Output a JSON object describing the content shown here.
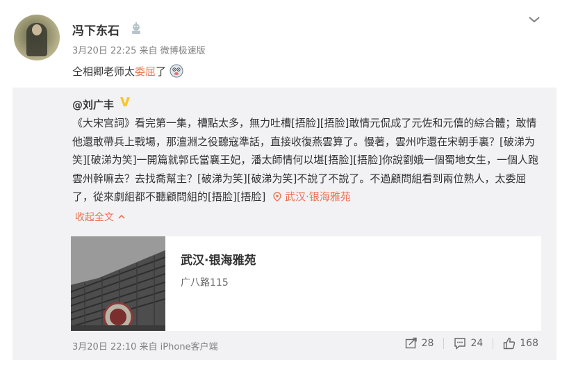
{
  "post": {
    "username": "冯下东石",
    "meta": "3月20日 22:25 来自 微博极速版",
    "text_before": "仝相卿老师太",
    "text_highlight": "委屈",
    "text_after": "了"
  },
  "quoted": {
    "author": "@刘广丰",
    "body": "《大宋宫詞》看完第一集，槽點太多，無力吐槽[捂脸][捂脸]敢情元侃成了元佐和元僖的綜合體；敢情他還敢帶兵上戰場，那澶淵之役聽寇準話，直接收復燕雲算了。慢著，雲州咋還在宋朝手裏？[破涕为笑][破涕为笑]一開篇就郭氏當襄王妃，潘太師情何以堪[捂脸][捂脸]你說劉娥一個蜀地女生，一個人跑雲州幹嘛去？去找喬幫主？[破涕为笑][破涕为笑]不說了不說了。不過顧問組看到兩位熟人，太委屈了，從來劇組都不聽顧問組的[捂脸][捂脸]",
    "location": "武汉·银海雅苑",
    "collapse_label": "收起全文",
    "card": {
      "title": "武汉·银海雅苑",
      "subtitle": "广八路115"
    },
    "footer_meta": "3月20日 22:10 来自 iPhone客户端",
    "reposts": "28",
    "comments": "24",
    "likes": "168"
  },
  "colors": {
    "accent": "#eb7350",
    "quote_bg": "#f2f2f5",
    "vbadge": "#f7c52d"
  },
  "icons": [
    "chevron-down-icon",
    "user-badge-icon",
    "emoji-icon",
    "vip-badge-icon",
    "location-pin-icon",
    "chevron-up-icon",
    "repost-icon",
    "comment-icon",
    "like-icon"
  ]
}
